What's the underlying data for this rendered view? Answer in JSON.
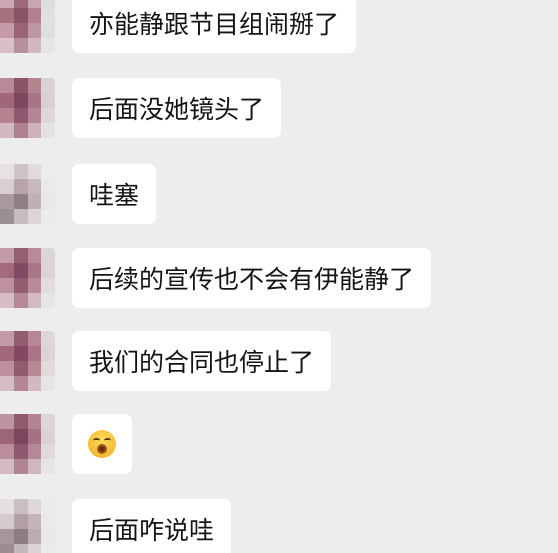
{
  "messages": [
    {
      "type": "text",
      "text": "亦能静跟节目组闹掰了"
    },
    {
      "type": "text",
      "text": "后面没她镜头了"
    },
    {
      "type": "text",
      "text": "哇塞"
    },
    {
      "type": "text",
      "text": "后续的宣传也不会有伊能静了"
    },
    {
      "type": "text",
      "text": "我们的合同也停止了"
    },
    {
      "type": "emoji",
      "icon": "astonished-face-emoji-icon"
    },
    {
      "type": "text",
      "text": "后面咋说哇"
    }
  ],
  "colors": {
    "background": "#ededed",
    "bubble": "#ffffff",
    "text": "#141414"
  }
}
